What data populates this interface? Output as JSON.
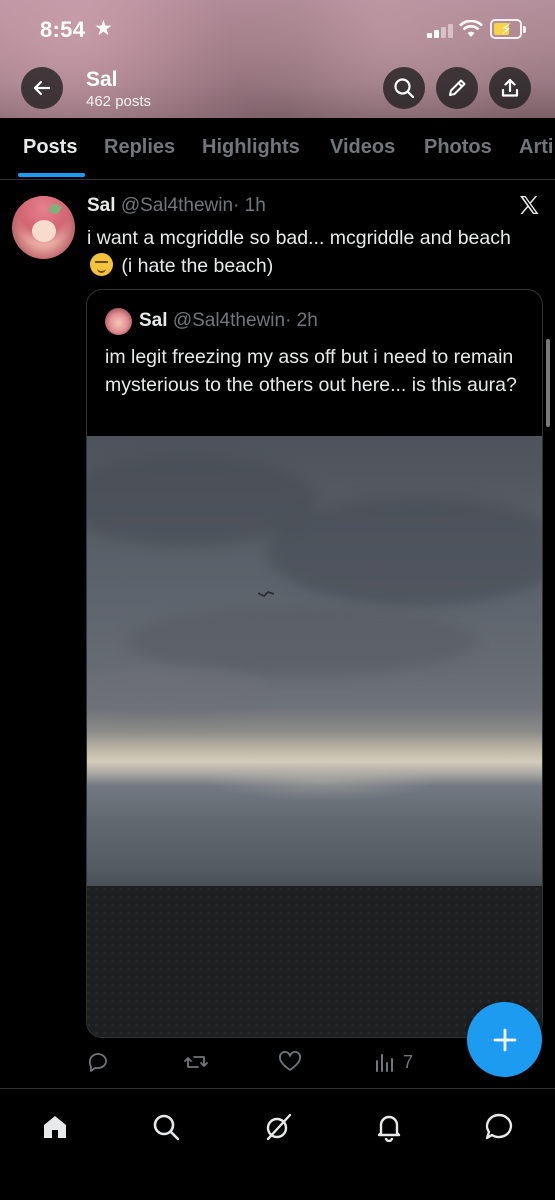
{
  "status_bar": {
    "time": "8:54",
    "star": "★"
  },
  "header": {
    "profile_name": "Sal",
    "posts_count": "462 posts",
    "icons": [
      "back-arrow-icon",
      "search-icon",
      "edit-pencil-icon",
      "share-icon"
    ]
  },
  "tabs": [
    {
      "label": "Posts",
      "active": true
    },
    {
      "label": "Replies",
      "active": false
    },
    {
      "label": "Highlights",
      "active": false
    },
    {
      "label": "Videos",
      "active": false
    },
    {
      "label": "Photos",
      "active": false
    },
    {
      "label": "Arti",
      "active": false
    }
  ],
  "tweet": {
    "name": "Sal",
    "handle": "@Sal4thewin",
    "time": "· 1h",
    "text_part1": "i want a mcgriddle so bad... mcgriddle and beach",
    "text_part2": "(i hate the beach)"
  },
  "quote": {
    "name": "Sal",
    "handle": "@Sal4thewin",
    "time": "· 2h",
    "text": "im legit freezing my ass off but i need to remain mysterious to the others out here... is this aura?"
  },
  "actions": {
    "views": "7"
  },
  "colors": {
    "accent": "#1d9bf0",
    "background": "#000000",
    "muted": "#71767b",
    "text": "#e7e9ea"
  }
}
